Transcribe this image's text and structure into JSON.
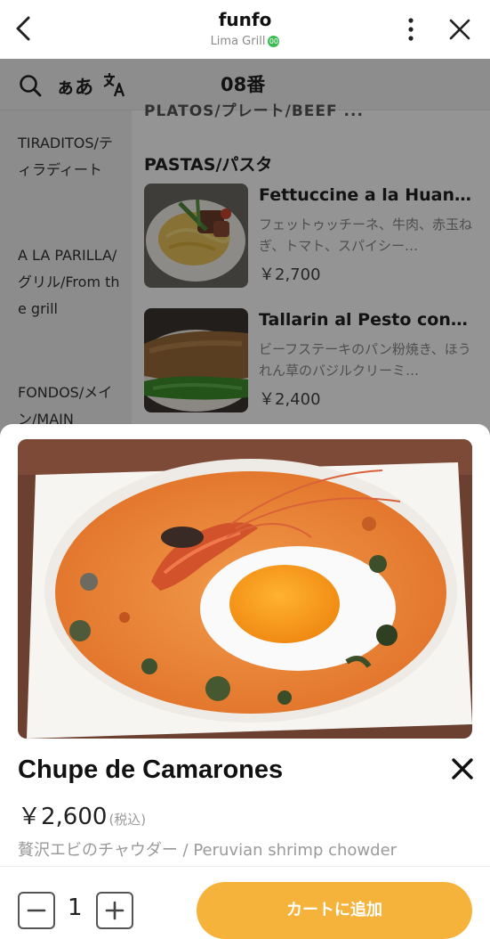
{
  "header": {
    "title": "funfo",
    "subtitle": "Lima Grill",
    "verified_mark": "00"
  },
  "toolbar": {
    "kana_label": "ぁあ",
    "table_number": "08番"
  },
  "sidebar": {
    "items": [
      {
        "label": "TIRADITOS/ティラディート"
      },
      {
        "label": "A LA PARILLA/グリル/From the grill"
      },
      {
        "label": "FONDOS/メイン/MAIN"
      }
    ]
  },
  "main": {
    "previous_section": "PLATOS/プレート/BEEF ...",
    "section_title": "PASTAS/パスタ",
    "items": [
      {
        "name": "Fettuccine a la Huan…",
        "desc": "フェットゥッチーネ、牛肉、赤玉ねぎ、トマト、スパイシー…",
        "price": "￥2,700"
      },
      {
        "name": "Tallarin al Pesto con …",
        "desc": "ビーフステーキのパン粉焼き、ほうれん草のバジルクリーミ…",
        "price": "￥2,400"
      }
    ]
  },
  "sheet": {
    "dish_name": "Chupe de Camarones",
    "price": "￥2,600",
    "tax_note": "(税込)",
    "description": "贅沢エビのチャウダー / Peruvian shrimp chowder",
    "quantity": "1",
    "add_to_cart_label": "カートに追加"
  },
  "colors": {
    "accent": "#f5b33c",
    "verified": "#3cba54"
  },
  "icons": [
    "back-arrow-icon",
    "more-vertical-icon",
    "close-icon",
    "search-icon",
    "translate-icon",
    "minus-icon",
    "plus-icon"
  ]
}
